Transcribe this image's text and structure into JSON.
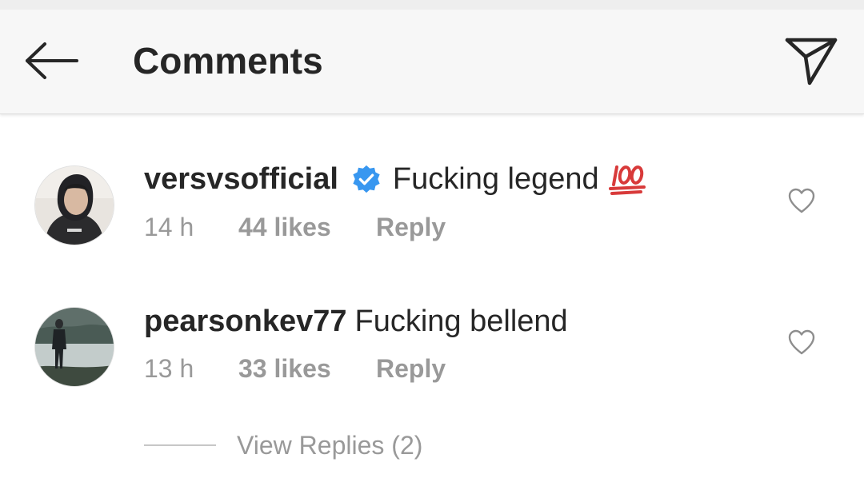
{
  "header": {
    "title": "Comments",
    "back_icon": "arrow-left-icon",
    "share_icon": "paper-plane-icon"
  },
  "comments": [
    {
      "username": "versvsofficial",
      "verified": true,
      "text": "Fucking legend",
      "emoji": "💯",
      "time": "14 h",
      "likes": "44 likes",
      "reply": "Reply"
    },
    {
      "username": "pearsonkev77",
      "verified": false,
      "text": "Fucking bellend",
      "time": "13 h",
      "likes": "33 likes",
      "reply": "Reply"
    }
  ],
  "view_replies": "View Replies (2)",
  "colors": {
    "text": "#262626",
    "secondary": "#999999",
    "verified": "#3897f0",
    "header_bg": "#f7f7f7",
    "emoji_red": "#d83a3a"
  }
}
